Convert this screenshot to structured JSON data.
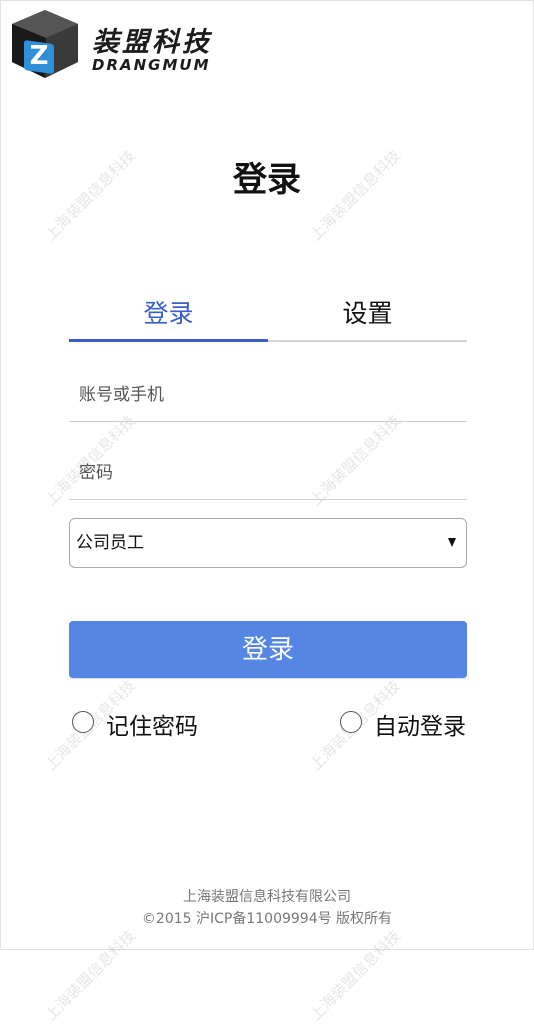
{
  "brand": {
    "logo_letter": "Z",
    "name_cn": "装盟科技",
    "name_en": "DRANGMUM"
  },
  "page": {
    "title": "登录"
  },
  "watermark": {
    "text": "上海装盟信息科技"
  },
  "tabs": [
    {
      "label": "登录",
      "active": true
    },
    {
      "label": "设置",
      "active": false
    }
  ],
  "form": {
    "account": {
      "placeholder": "账号或手机",
      "value": ""
    },
    "password": {
      "placeholder": "密码",
      "value": ""
    },
    "role_select": {
      "selected": "公司员工"
    },
    "login_button": "登录",
    "remember_password": "记住密码",
    "auto_login": "自动登录"
  },
  "footer": {
    "company": "上海装盟信息科技有限公司",
    "copyright": "©2015 沪ICP备11009994号 版权所有"
  },
  "colors": {
    "accent": "#3b5fc7",
    "button": "#5586e3"
  }
}
